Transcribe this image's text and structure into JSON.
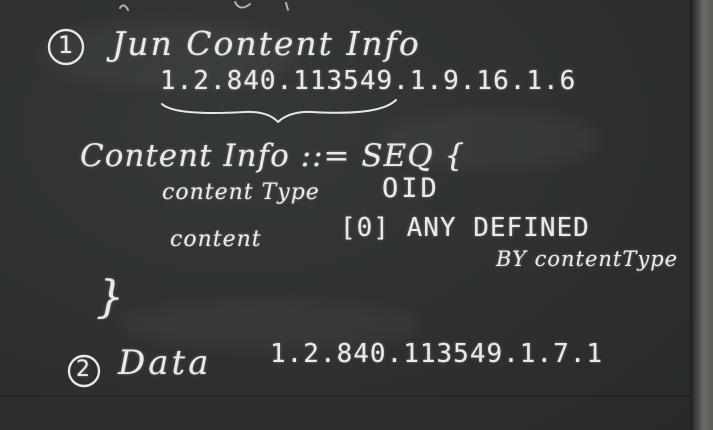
{
  "item1": {
    "marker": "1",
    "title": "Jun Content Info",
    "oid": "1.2.840.113549.1.9.16.1.6"
  },
  "definition": {
    "header": "Content Info ::= SEQ {",
    "type_field": "content Type",
    "type_value": "OID",
    "content_field": "content",
    "content_value": "[0] ANY DEFINED",
    "content_value_cont": "BY contentType",
    "close_brace": "}"
  },
  "item2": {
    "marker": "2",
    "title": "Data",
    "oid": "1.2.840.113549.1.7.1"
  },
  "colors": {
    "chalkboard": "#2e312e",
    "chalk": "#e9ebe6",
    "frame": "#5a5b57"
  }
}
